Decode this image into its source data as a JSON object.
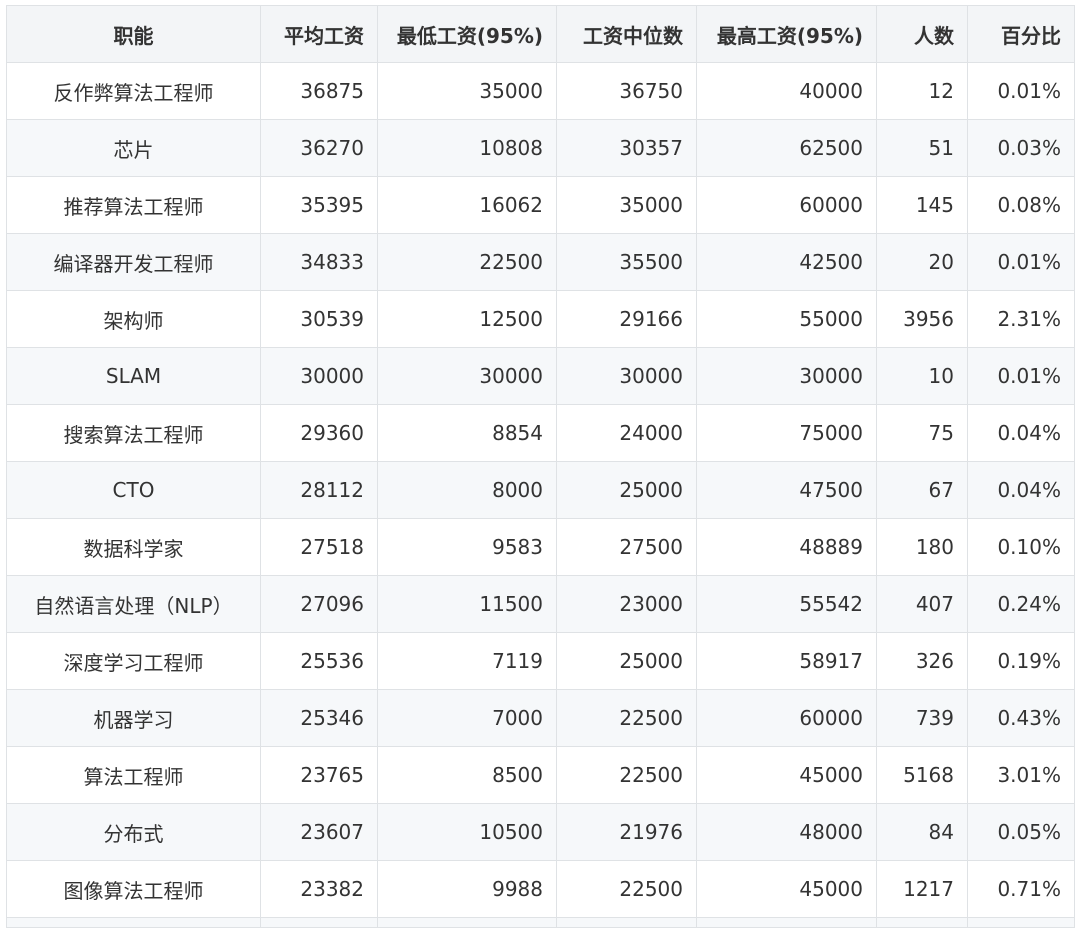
{
  "table": {
    "headers": [
      "职能",
      "平均工资",
      "最低工资(95%)",
      "工资中位数",
      "最高工资(95%)",
      "人数",
      "百分比"
    ],
    "rows": [
      [
        "反作弊算法工程师",
        "36875",
        "35000",
        "36750",
        "40000",
        "12",
        "0.01%"
      ],
      [
        "芯片",
        "36270",
        "10808",
        "30357",
        "62500",
        "51",
        "0.03%"
      ],
      [
        "推荐算法工程师",
        "35395",
        "16062",
        "35000",
        "60000",
        "145",
        "0.08%"
      ],
      [
        "编译器开发工程师",
        "34833",
        "22500",
        "35500",
        "42500",
        "20",
        "0.01%"
      ],
      [
        "架构师",
        "30539",
        "12500",
        "29166",
        "55000",
        "3956",
        "2.31%"
      ],
      [
        "SLAM",
        "30000",
        "30000",
        "30000",
        "30000",
        "10",
        "0.01%"
      ],
      [
        "搜索算法工程师",
        "29360",
        "8854",
        "24000",
        "75000",
        "75",
        "0.04%"
      ],
      [
        "CTO",
        "28112",
        "8000",
        "25000",
        "47500",
        "67",
        "0.04%"
      ],
      [
        "数据科学家",
        "27518",
        "9583",
        "27500",
        "48889",
        "180",
        "0.10%"
      ],
      [
        "自然语言处理（NLP）",
        "27096",
        "11500",
        "23000",
        "55542",
        "407",
        "0.24%"
      ],
      [
        "深度学习工程师",
        "25536",
        "7119",
        "25000",
        "58917",
        "326",
        "0.19%"
      ],
      [
        "机器学习",
        "25346",
        "7000",
        "22500",
        "60000",
        "739",
        "0.43%"
      ],
      [
        "算法工程师",
        "23765",
        "8500",
        "22500",
        "45000",
        "5168",
        "3.01%"
      ],
      [
        "分布式",
        "23607",
        "10500",
        "21976",
        "48000",
        "84",
        "0.05%"
      ],
      [
        "图像算法工程师",
        "23382",
        "9988",
        "22500",
        "45000",
        "1217",
        "0.71%"
      ]
    ]
  }
}
